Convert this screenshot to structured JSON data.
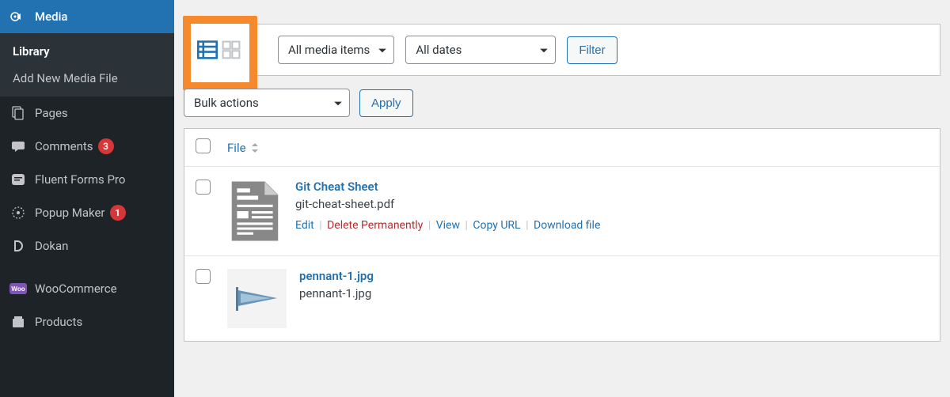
{
  "sidebar": {
    "media": {
      "label": "Media"
    },
    "submenu": {
      "library": "Library",
      "add_new": "Add New Media File"
    },
    "items": [
      {
        "label": "Pages"
      },
      {
        "label": "Comments",
        "badge": "3"
      },
      {
        "label": "Fluent Forms Pro"
      },
      {
        "label": "Popup Maker",
        "badge": "1"
      },
      {
        "label": "Dokan"
      },
      {
        "label": "WooCommerce"
      },
      {
        "label": "Products"
      }
    ]
  },
  "toolbar": {
    "media_filter": "All media items",
    "date_filter": "All dates",
    "filter_btn": "Filter"
  },
  "bulk": {
    "label": "Bulk actions",
    "apply": "Apply"
  },
  "table": {
    "file_header": "File",
    "rows": [
      {
        "title": "Git Cheat Sheet",
        "filename": "git-cheat-sheet.pdf",
        "actions": {
          "edit": "Edit",
          "delete": "Delete Permanently",
          "view": "View",
          "copy": "Copy URL",
          "download": "Download file"
        }
      },
      {
        "title": "pennant-1.jpg",
        "filename": "pennant-1.jpg"
      }
    ]
  }
}
